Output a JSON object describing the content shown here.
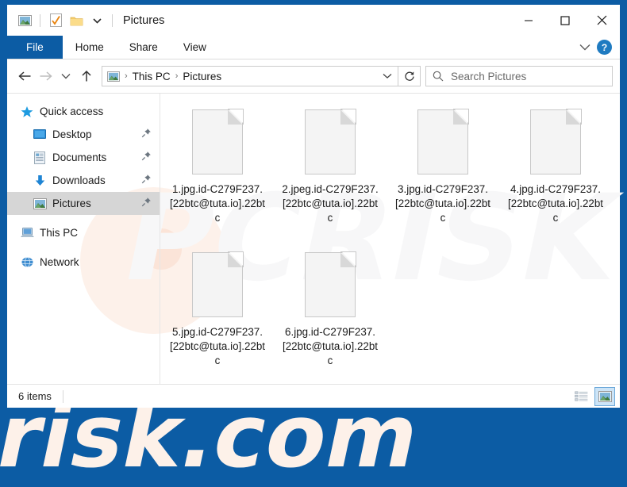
{
  "window": {
    "title": "Pictures",
    "quick_access_toolbar": [
      {
        "name": "pictures-library-icon",
        "label": "Pictures library"
      },
      {
        "name": "properties-icon",
        "label": "Properties"
      },
      {
        "name": "new-folder-icon",
        "label": "New folder"
      },
      {
        "name": "customize-chevron-icon",
        "label": "Customize Quick Access Toolbar"
      }
    ],
    "controls": {
      "minimize": "–",
      "maximize": "☐",
      "close": "✕"
    }
  },
  "ribbon": {
    "tabs": [
      {
        "label": "File",
        "active": true
      },
      {
        "label": "Home",
        "active": false
      },
      {
        "label": "Share",
        "active": false
      },
      {
        "label": "View",
        "active": false
      }
    ],
    "collapse_icon": "chevron-down-icon",
    "help_label": "?"
  },
  "nav": {
    "back_label": "Back",
    "forward_label": "Forward",
    "recent_label": "Recent locations",
    "up_label": "Up",
    "refresh_label": "Refresh",
    "address": {
      "icon": "pictures-folder-icon",
      "crumbs": [
        "This PC",
        "Pictures"
      ],
      "separator": "›",
      "dropdown_icon": "chevron-down-icon"
    }
  },
  "search": {
    "placeholder": "Search Pictures",
    "icon": "search-icon"
  },
  "sidebar": {
    "items": [
      {
        "label": "Quick access",
        "icon": "star-icon",
        "level": 0,
        "pinned": false,
        "selected": false
      },
      {
        "label": "Desktop",
        "icon": "desktop-icon",
        "level": 1,
        "pinned": true,
        "selected": false
      },
      {
        "label": "Documents",
        "icon": "documents-icon",
        "level": 1,
        "pinned": true,
        "selected": false
      },
      {
        "label": "Downloads",
        "icon": "downloads-icon",
        "level": 1,
        "pinned": true,
        "selected": false
      },
      {
        "label": "Pictures",
        "icon": "pictures-icon",
        "level": 1,
        "pinned": true,
        "selected": true
      },
      {
        "label": "This PC",
        "icon": "this-pc-icon",
        "level": 0,
        "pinned": false,
        "selected": false
      },
      {
        "label": "Network",
        "icon": "network-icon",
        "level": 0,
        "pinned": false,
        "selected": false
      }
    ]
  },
  "files": [
    {
      "name": "1.jpg.id-C279F237.[22btc@tuta.io].22btc",
      "icon": "generic-file-icon"
    },
    {
      "name": "2.jpeg.id-C279F237.[22btc@tuta.io].22btc",
      "icon": "generic-file-icon"
    },
    {
      "name": "3.jpg.id-C279F237.[22btc@tuta.io].22btc",
      "icon": "generic-file-icon"
    },
    {
      "name": "4.jpg.id-C279F237.[22btc@tuta.io].22btc",
      "icon": "generic-file-icon"
    },
    {
      "name": "5.jpg.id-C279F237.[22btc@tuta.io].22btc",
      "icon": "generic-file-icon"
    },
    {
      "name": "6.jpg.id-C279F237.[22btc@tuta.io].22btc",
      "icon": "generic-file-icon"
    }
  ],
  "status": {
    "item_count": "6 items",
    "views": [
      {
        "name": "details-view-button",
        "label": "Details view",
        "active": false
      },
      {
        "name": "large-icons-view-button",
        "label": "Large icons view",
        "active": true
      }
    ]
  },
  "watermark": {
    "top": "PCRISK",
    "bottom": "risk.com"
  },
  "colors": {
    "accent": "#0c5ca4",
    "selection": "#d6d6d6",
    "help_blue": "#1f7bc1",
    "watermark_warm": "#fdf1e9"
  }
}
